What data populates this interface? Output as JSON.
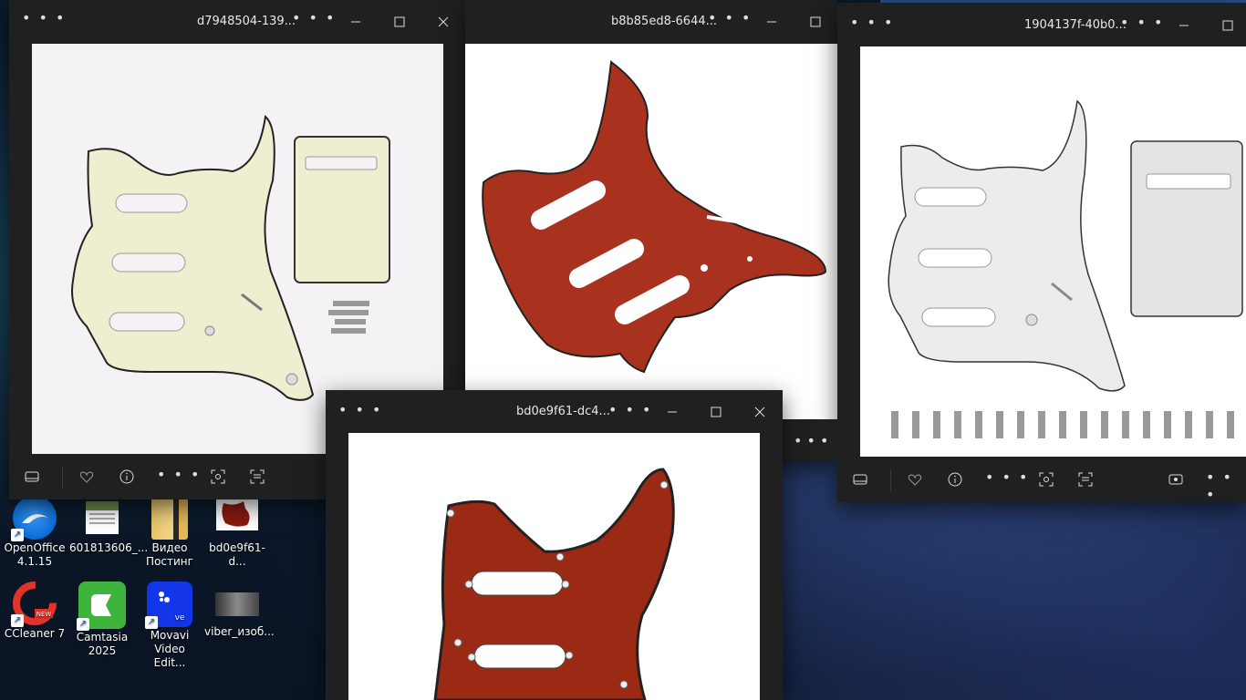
{
  "windows": {
    "w1": {
      "title": "d7948504-139..."
    },
    "w2": {
      "title": "b8b85ed8-6644..."
    },
    "w3": {
      "title": "1904137f-40b0..."
    },
    "w4": {
      "title": "bd0e9f61-dc4..."
    }
  },
  "menu_glyph": "• • •",
  "desktop_icons": [
    {
      "label": "OpenOffice 4.1.15",
      "icon": "openoffice-icon"
    },
    {
      "label": "601813606_...",
      "icon": "image-thumbnail-icon"
    },
    {
      "label": "Видео Постинг",
      "icon": "folder-icon"
    },
    {
      "label": "bd0e9f61-d...",
      "icon": "image-thumbnail-icon"
    },
    {
      "label": "CCleaner 7",
      "icon": "ccleaner-icon"
    },
    {
      "label": "Camtasia 2025",
      "icon": "camtasia-icon"
    },
    {
      "label": "Movavi Video Edit...",
      "icon": "movavi-icon"
    },
    {
      "label": "viber_изоб...",
      "icon": "image-thumbnail-icon"
    }
  ],
  "colors": {
    "window_bg": "#202020",
    "pickguard_cream": "#efeed0",
    "pickguard_tortoise": "#a8321e",
    "pickguard_white": "#ececec"
  }
}
